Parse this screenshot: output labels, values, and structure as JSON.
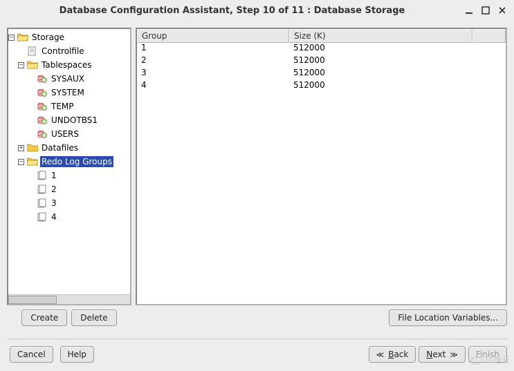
{
  "window": {
    "title": "Database Configuration Assistant, Step 10 of 11 : Database Storage"
  },
  "tree": {
    "root": "Storage",
    "controlfile": "Controlfile",
    "tablespaces": "Tablespaces",
    "ts_items": [
      "SYSAUX",
      "SYSTEM",
      "TEMP",
      "UNDOTBS1",
      "USERS"
    ],
    "datafiles": "Datafiles",
    "redo": "Redo Log Groups",
    "redo_items": [
      "1",
      "2",
      "3",
      "4"
    ]
  },
  "left_buttons": {
    "create": "Create",
    "delete": "Delete"
  },
  "table": {
    "headers": {
      "group": "Group",
      "size": "Size (K)"
    },
    "rows": [
      {
        "group": "1",
        "size": "512000"
      },
      {
        "group": "2",
        "size": "512000"
      },
      {
        "group": "3",
        "size": "512000"
      },
      {
        "group": "4",
        "size": "512000"
      }
    ]
  },
  "right_buttons": {
    "file_loc": "File Location Variables..."
  },
  "footer": {
    "cancel": "Cancel",
    "help": "Help",
    "back": "Back",
    "next": "Next",
    "finish": "Finish"
  },
  "watermark": "亿速云"
}
